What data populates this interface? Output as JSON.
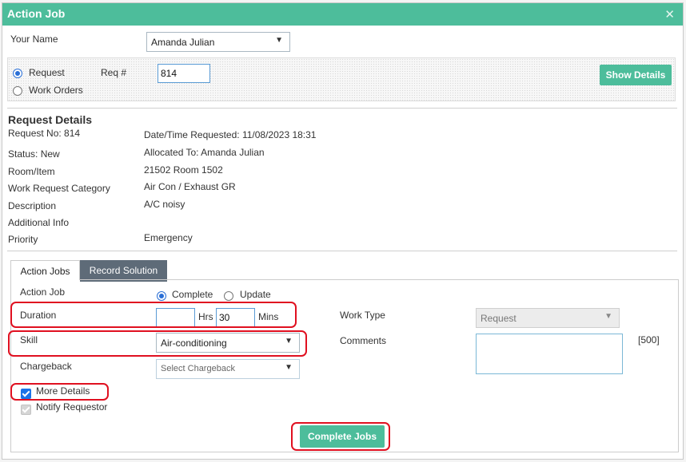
{
  "dialog": {
    "title": "Action Job",
    "close_glyph": "✕"
  },
  "your_name": {
    "label": "Your Name",
    "value": "Amanda Julian"
  },
  "request_panel": {
    "radio_request": "Request",
    "radio_work_orders": "Work Orders",
    "req_num_label": "Req #",
    "req_num_value": "814",
    "show_details": "Show Details"
  },
  "request_details": {
    "title": "Request Details",
    "request_no": "Request No: 814",
    "date_time": "Date/Time Requested: 11/08/2023 18:31",
    "status": "Status: New",
    "allocated_to": "Allocated To: Amanda Julian",
    "room_label": "Room/Item",
    "room_value": "21502 Room 1502",
    "category_label": "Work Request Category",
    "category_value": "Air Con / Exhaust GR",
    "description_label": "Description",
    "description_value": "A/C noisy",
    "additional_label": "Additional Info",
    "priority_label": "Priority",
    "priority_value": "Emergency"
  },
  "tabs": {
    "action_jobs": "Action Jobs",
    "record_solution": "Record Solution"
  },
  "action_form": {
    "action_job_label": "Action Job",
    "complete": "Complete",
    "update": "Update",
    "duration_label": "Duration",
    "hrs_value": "",
    "hrs_label": "Hrs",
    "mins_value": "30",
    "mins_label": "Mins",
    "work_type_label": "Work Type",
    "work_type_value": "Request",
    "skill_label": "Skill",
    "skill_value": "Air-conditioning",
    "comments_label": "Comments",
    "comments_limit": "[500]",
    "chargeback_label": "Chargeback",
    "chargeback_placeholder": "Select Chargeback",
    "more_details": "More Details",
    "notify_requestor": "Notify Requestor",
    "complete_jobs": "Complete Jobs"
  },
  "colors": {
    "accent": "#4dbd9b",
    "highlight": "#e01020",
    "tab_inactive": "#5e6b78"
  },
  "icons": {
    "dropdown": "chevron-down-icon",
    "close": "close-icon"
  }
}
